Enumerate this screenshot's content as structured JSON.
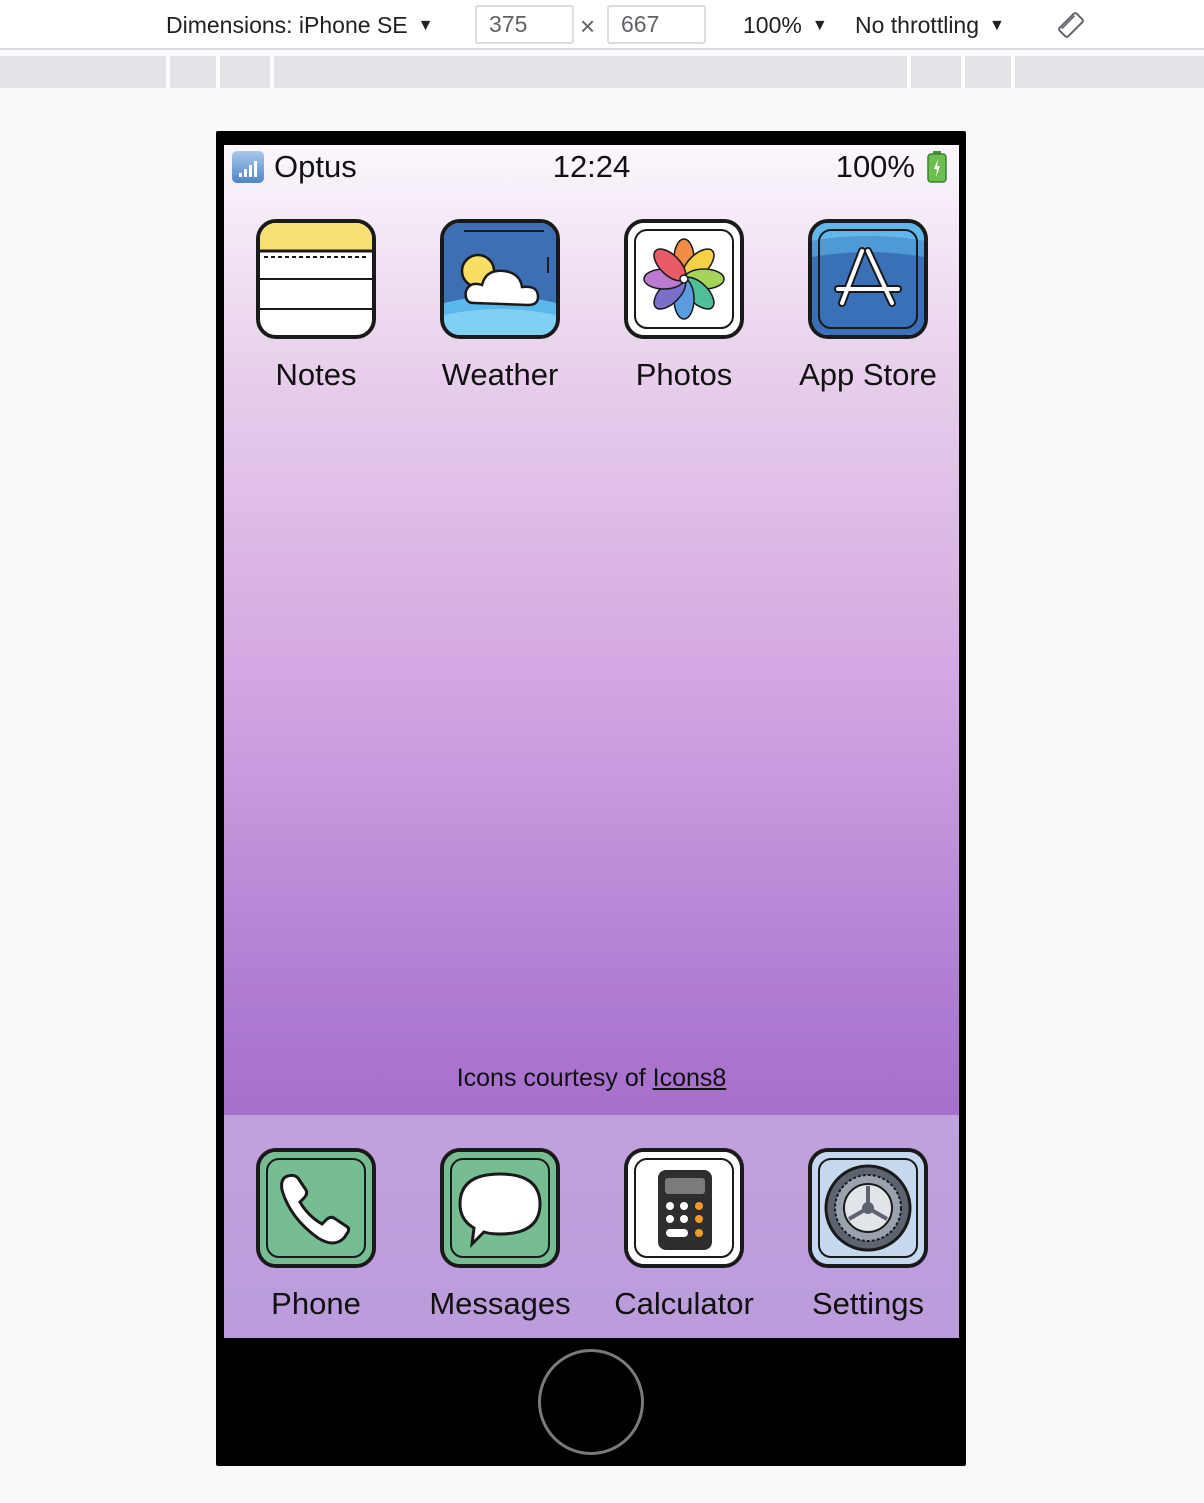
{
  "toolbar": {
    "dimensions_label": "Dimensions: iPhone SE",
    "width_value": "375",
    "times": "×",
    "height_value": "667",
    "zoom": "100%",
    "throttling": "No throttling",
    "caret": "▼"
  },
  "status_bar": {
    "carrier": "Optus",
    "time": "12:24",
    "battery": "100%"
  },
  "home_apps": [
    {
      "label": "Notes"
    },
    {
      "label": "Weather"
    },
    {
      "label": "Photos"
    },
    {
      "label": "App Store"
    }
  ],
  "credit": {
    "prefix": "Icons courtesy of ",
    "link": "Icons8"
  },
  "dock_apps": [
    {
      "label": "Phone"
    },
    {
      "label": "Messages"
    },
    {
      "label": "Calculator"
    },
    {
      "label": "Settings"
    }
  ],
  "colors": {
    "notes_yellow": "#f7e172",
    "weather_blue": "#3d6fb5",
    "appstore_blue": "#3a70b8",
    "phone_green": "#76bd92",
    "settings_blue": "#c5d8ee"
  }
}
